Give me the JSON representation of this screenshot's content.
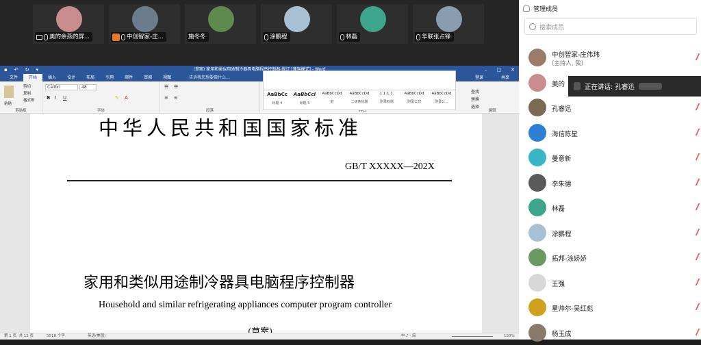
{
  "participants": [
    {
      "name": "美的余燕的屏...",
      "icon": "screen-share-icon",
      "color": "#c98d8d"
    },
    {
      "name": "中创智家-庄...",
      "icon": "host-icon",
      "color": "#6b7c8c"
    },
    {
      "name": "施冬冬",
      "icon": "",
      "color": "#5f8a4e"
    },
    {
      "name": "涂鹏程",
      "icon": "mic-icon",
      "color": "#a8c0d4"
    },
    {
      "name": "林磊",
      "icon": "mic-icon",
      "color": "#3da58a"
    },
    {
      "name": "华联张占锋",
      "icon": "mic-icon",
      "color": "#8a9cb0"
    }
  ],
  "word": {
    "title": "(草案) 家用和类似用途制冷器具电脑程序控制器-修订 [兼容模式] - Word",
    "menu": [
      "文件",
      "开始",
      "插入",
      "设计",
      "布局",
      "引用",
      "邮件",
      "审阅",
      "视图"
    ],
    "tell_me": "告诉我您想要做什么...",
    "login": "登录",
    "share": "共享",
    "font_name": "Calibri",
    "font_size": "48",
    "groups": {
      "clipboard": "剪贴板",
      "font": "字体",
      "paragraph": "段落",
      "styles": "样式",
      "edit": "编辑"
    },
    "clip": {
      "paste": "粘贴",
      "cut": "剪切",
      "copy": "复制",
      "painter": "格式刷"
    },
    "styles": [
      {
        "preview": "AaBbCc",
        "name": "标题 4"
      },
      {
        "preview": "AaBbCcI",
        "name": "标题 5"
      },
      {
        "preview": "AaBbCcDd",
        "name": "前"
      },
      {
        "preview": "AaBbCcDd",
        "name": "二级条标题"
      },
      {
        "preview": "1.1.1.1.",
        "name": "附录标题"
      },
      {
        "preview": "AaBbCcDd",
        "name": "附录公式"
      },
      {
        "preview": "AaBbCcDd",
        "name": "附录公..."
      }
    ],
    "edit": [
      "查找",
      "替换",
      "选择"
    ]
  },
  "document": {
    "heading": "中华人民共和国国家标准",
    "std_number": "GB/T XXXXX—202X",
    "title_cn": "家用和类似用途制冷器具电脑程序控制器",
    "title_en": "Household and similar refrigerating appliances computer program controller",
    "draft": "(草案)"
  },
  "status": {
    "page": "第 1 页, 共 12 页",
    "words": "5518 个字",
    "lang": "英语(美国)",
    "ime": "中 ♪ · 简",
    "zoom": "150%"
  },
  "sidebar": {
    "title": "管理成员",
    "search_placeholder": "搜索成员",
    "speaking": "正在讲话: 孔睿迅",
    "members": [
      {
        "name": "中创智家-庄伟玮",
        "sub": "(主持人, 我)",
        "color": "#9c7b6b"
      },
      {
        "name": "美的",
        "sub": "",
        "color": "#c98d8d"
      },
      {
        "name": "孔睿迅",
        "sub": "",
        "color": "#7a6a52"
      },
      {
        "name": "海信陈星",
        "sub": "",
        "color": "#2d7fd6"
      },
      {
        "name": "曼意新",
        "sub": "",
        "color": "#3ab5c6"
      },
      {
        "name": "李朱德",
        "sub": "",
        "color": "#5a5a5a"
      },
      {
        "name": "林磊",
        "sub": "",
        "color": "#3da58a"
      },
      {
        "name": "涂鹏程",
        "sub": "",
        "color": "#a8c0d4"
      },
      {
        "name": "拓邦-涂娇娇",
        "sub": "",
        "color": "#6a9a62"
      },
      {
        "name": "王强",
        "sub": "",
        "color": "#d8d8d8"
      },
      {
        "name": "星帅尔-吴红彪",
        "sub": "",
        "color": "#d0a020"
      },
      {
        "name": "杨玉成",
        "sub": "",
        "color": "#8a7a6a"
      }
    ]
  },
  "colors": {
    "word_blue": "#2b579a",
    "mute_red": "#f15b5b"
  }
}
